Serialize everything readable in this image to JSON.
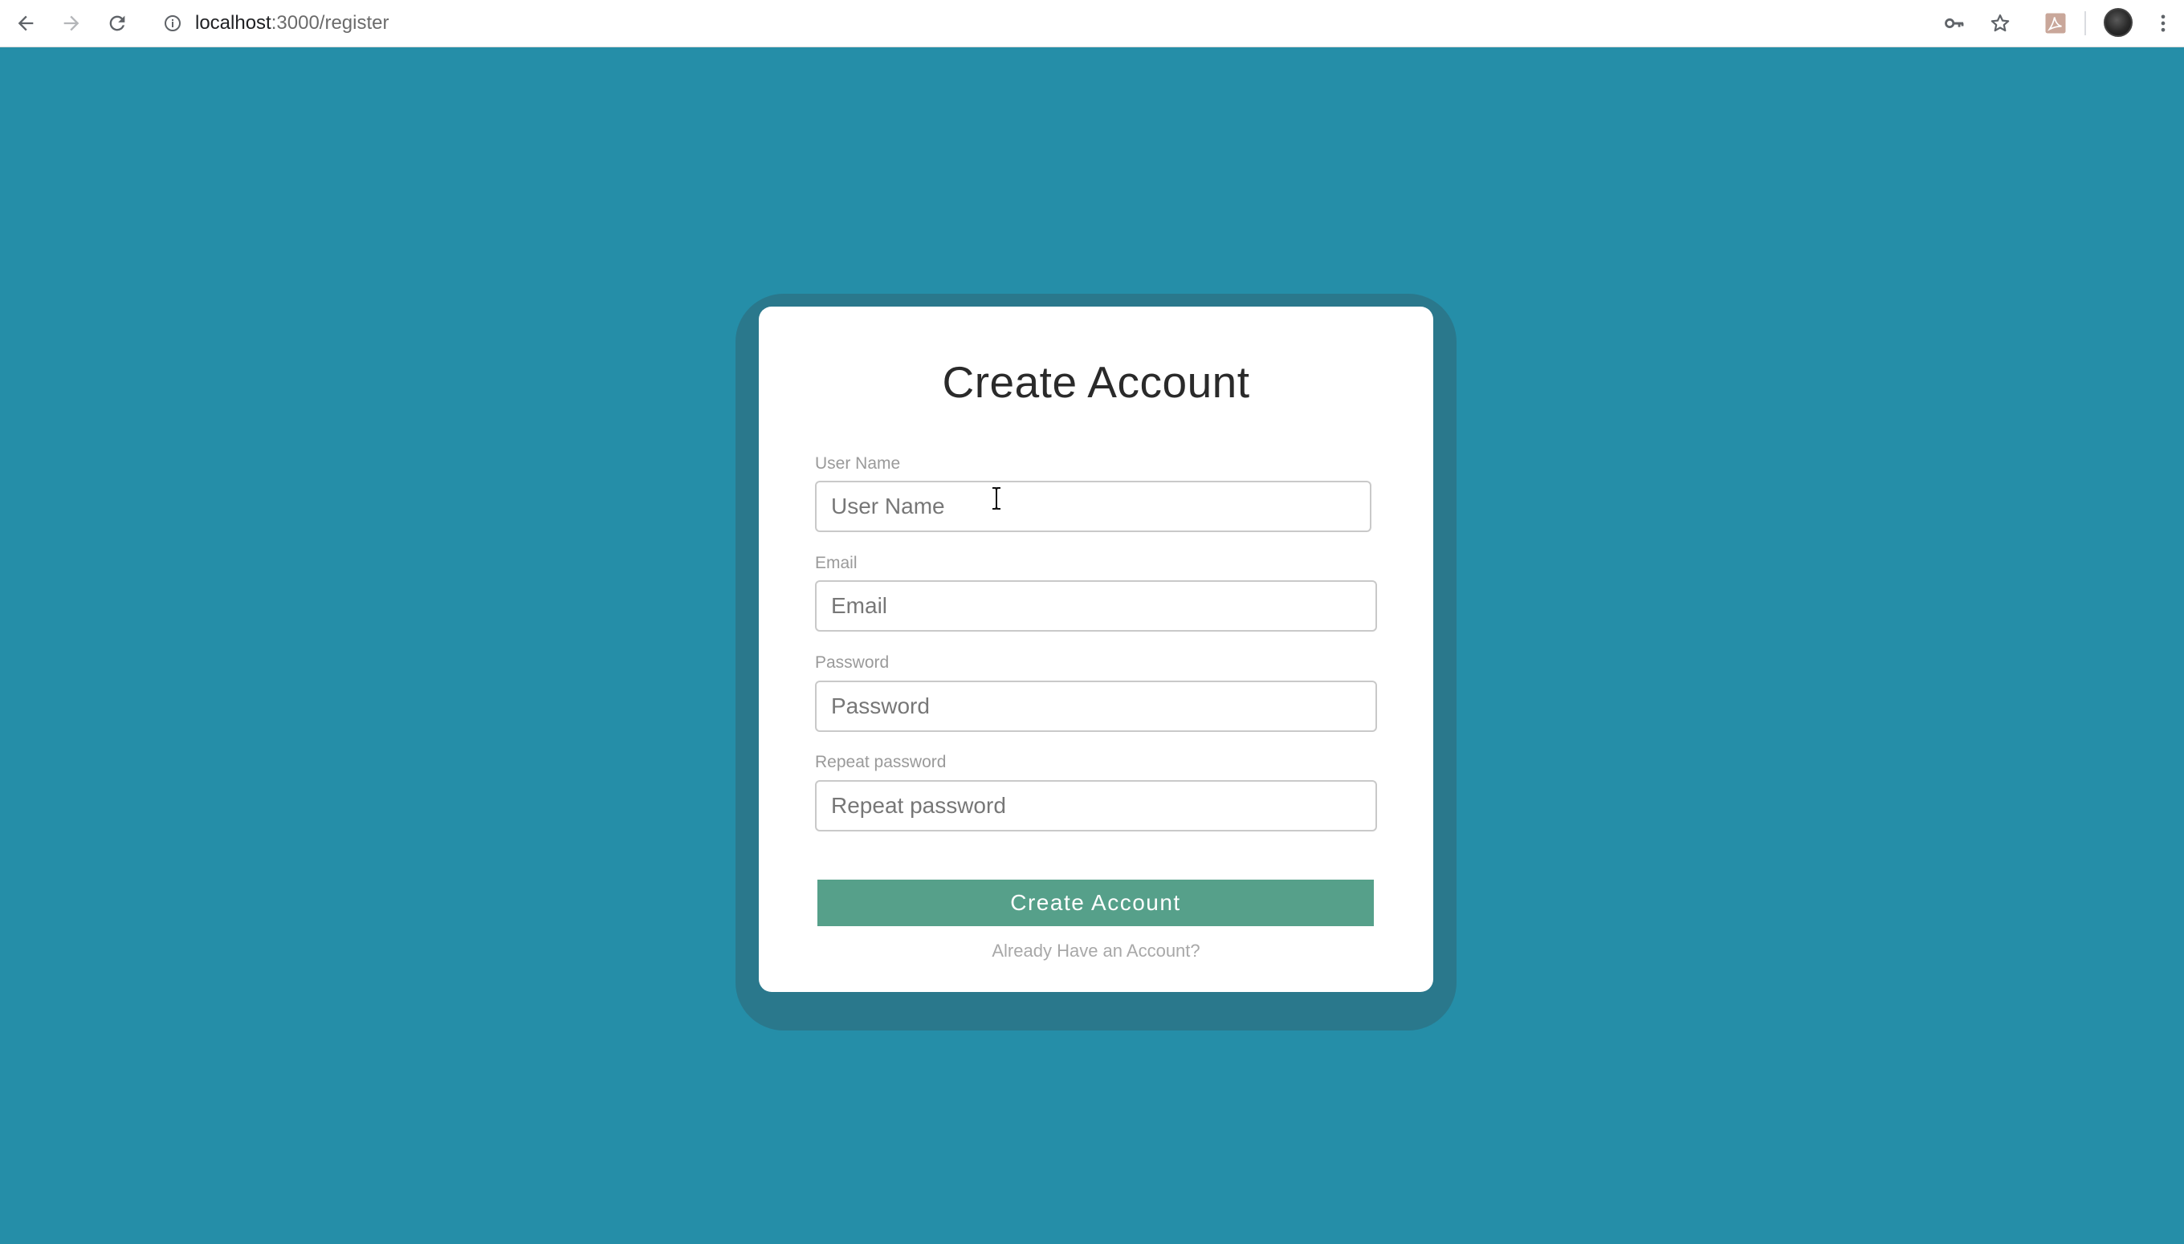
{
  "browser": {
    "url_host": "localhost",
    "url_path": ":3000/register",
    "icons": [
      "back-arrow-icon",
      "forward-arrow-icon",
      "reload-icon",
      "info-icon",
      "key-icon",
      "star-icon",
      "pdf-extension-icon",
      "avatar",
      "more-vert-icon"
    ]
  },
  "page": {
    "background_color": "#258ea8",
    "card_title": "Create Account",
    "fields": [
      {
        "label": "User Name",
        "placeholder": "User Name",
        "value": ""
      },
      {
        "label": "Email",
        "placeholder": "Email",
        "value": ""
      },
      {
        "label": "Password",
        "placeholder": "Password",
        "value": ""
      },
      {
        "label": "Repeat password",
        "placeholder": "Repeat password",
        "value": ""
      }
    ],
    "submit_label": "Create Account",
    "submit_color": "#56a08a",
    "login_link": "Already Have an Account?"
  }
}
